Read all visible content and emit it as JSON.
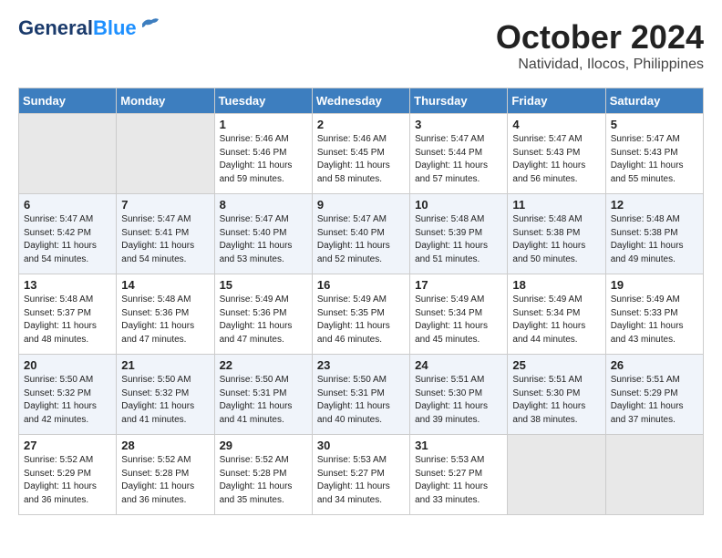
{
  "header": {
    "logo_line1": "General",
    "logo_line2": "Blue",
    "month_year": "October 2024",
    "location": "Natividad, Ilocos, Philippines"
  },
  "weekdays": [
    "Sunday",
    "Monday",
    "Tuesday",
    "Wednesday",
    "Thursday",
    "Friday",
    "Saturday"
  ],
  "weeks": [
    [
      {
        "day": "",
        "info": ""
      },
      {
        "day": "",
        "info": ""
      },
      {
        "day": "1",
        "info": "Sunrise: 5:46 AM\nSunset: 5:46 PM\nDaylight: 11 hours\nand 59 minutes."
      },
      {
        "day": "2",
        "info": "Sunrise: 5:46 AM\nSunset: 5:45 PM\nDaylight: 11 hours\nand 58 minutes."
      },
      {
        "day": "3",
        "info": "Sunrise: 5:47 AM\nSunset: 5:44 PM\nDaylight: 11 hours\nand 57 minutes."
      },
      {
        "day": "4",
        "info": "Sunrise: 5:47 AM\nSunset: 5:43 PM\nDaylight: 11 hours\nand 56 minutes."
      },
      {
        "day": "5",
        "info": "Sunrise: 5:47 AM\nSunset: 5:43 PM\nDaylight: 11 hours\nand 55 minutes."
      }
    ],
    [
      {
        "day": "6",
        "info": "Sunrise: 5:47 AM\nSunset: 5:42 PM\nDaylight: 11 hours\nand 54 minutes."
      },
      {
        "day": "7",
        "info": "Sunrise: 5:47 AM\nSunset: 5:41 PM\nDaylight: 11 hours\nand 54 minutes."
      },
      {
        "day": "8",
        "info": "Sunrise: 5:47 AM\nSunset: 5:40 PM\nDaylight: 11 hours\nand 53 minutes."
      },
      {
        "day": "9",
        "info": "Sunrise: 5:47 AM\nSunset: 5:40 PM\nDaylight: 11 hours\nand 52 minutes."
      },
      {
        "day": "10",
        "info": "Sunrise: 5:48 AM\nSunset: 5:39 PM\nDaylight: 11 hours\nand 51 minutes."
      },
      {
        "day": "11",
        "info": "Sunrise: 5:48 AM\nSunset: 5:38 PM\nDaylight: 11 hours\nand 50 minutes."
      },
      {
        "day": "12",
        "info": "Sunrise: 5:48 AM\nSunset: 5:38 PM\nDaylight: 11 hours\nand 49 minutes."
      }
    ],
    [
      {
        "day": "13",
        "info": "Sunrise: 5:48 AM\nSunset: 5:37 PM\nDaylight: 11 hours\nand 48 minutes."
      },
      {
        "day": "14",
        "info": "Sunrise: 5:48 AM\nSunset: 5:36 PM\nDaylight: 11 hours\nand 47 minutes."
      },
      {
        "day": "15",
        "info": "Sunrise: 5:49 AM\nSunset: 5:36 PM\nDaylight: 11 hours\nand 47 minutes."
      },
      {
        "day": "16",
        "info": "Sunrise: 5:49 AM\nSunset: 5:35 PM\nDaylight: 11 hours\nand 46 minutes."
      },
      {
        "day": "17",
        "info": "Sunrise: 5:49 AM\nSunset: 5:34 PM\nDaylight: 11 hours\nand 45 minutes."
      },
      {
        "day": "18",
        "info": "Sunrise: 5:49 AM\nSunset: 5:34 PM\nDaylight: 11 hours\nand 44 minutes."
      },
      {
        "day": "19",
        "info": "Sunrise: 5:49 AM\nSunset: 5:33 PM\nDaylight: 11 hours\nand 43 minutes."
      }
    ],
    [
      {
        "day": "20",
        "info": "Sunrise: 5:50 AM\nSunset: 5:32 PM\nDaylight: 11 hours\nand 42 minutes."
      },
      {
        "day": "21",
        "info": "Sunrise: 5:50 AM\nSunset: 5:32 PM\nDaylight: 11 hours\nand 41 minutes."
      },
      {
        "day": "22",
        "info": "Sunrise: 5:50 AM\nSunset: 5:31 PM\nDaylight: 11 hours\nand 41 minutes."
      },
      {
        "day": "23",
        "info": "Sunrise: 5:50 AM\nSunset: 5:31 PM\nDaylight: 11 hours\nand 40 minutes."
      },
      {
        "day": "24",
        "info": "Sunrise: 5:51 AM\nSunset: 5:30 PM\nDaylight: 11 hours\nand 39 minutes."
      },
      {
        "day": "25",
        "info": "Sunrise: 5:51 AM\nSunset: 5:30 PM\nDaylight: 11 hours\nand 38 minutes."
      },
      {
        "day": "26",
        "info": "Sunrise: 5:51 AM\nSunset: 5:29 PM\nDaylight: 11 hours\nand 37 minutes."
      }
    ],
    [
      {
        "day": "27",
        "info": "Sunrise: 5:52 AM\nSunset: 5:29 PM\nDaylight: 11 hours\nand 36 minutes."
      },
      {
        "day": "28",
        "info": "Sunrise: 5:52 AM\nSunset: 5:28 PM\nDaylight: 11 hours\nand 36 minutes."
      },
      {
        "day": "29",
        "info": "Sunrise: 5:52 AM\nSunset: 5:28 PM\nDaylight: 11 hours\nand 35 minutes."
      },
      {
        "day": "30",
        "info": "Sunrise: 5:53 AM\nSunset: 5:27 PM\nDaylight: 11 hours\nand 34 minutes."
      },
      {
        "day": "31",
        "info": "Sunrise: 5:53 AM\nSunset: 5:27 PM\nDaylight: 11 hours\nand 33 minutes."
      },
      {
        "day": "",
        "info": ""
      },
      {
        "day": "",
        "info": ""
      }
    ]
  ]
}
